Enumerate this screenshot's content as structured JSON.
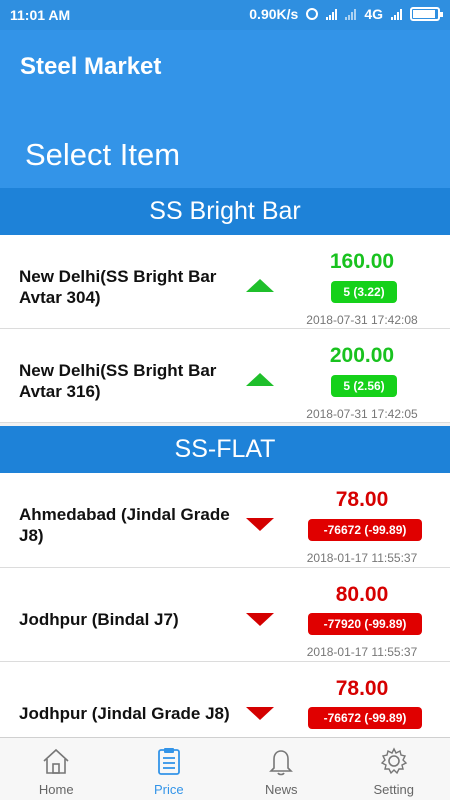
{
  "status_bar": {
    "time": "11:01 AM",
    "speed": "0.90K/s",
    "network": "4G"
  },
  "app_bar": {
    "title": "Steel Market",
    "subtitle": "Select Item"
  },
  "sections": [
    {
      "title": "SS Bright Bar",
      "rows": [
        {
          "name": "New Delhi(SS Bright Bar Avtar 304)",
          "direction": "up",
          "price": "160.00",
          "change": "5 (3.22)",
          "timestamp": "2018-07-31 17:42:08"
        },
        {
          "name": "New Delhi(SS Bright Bar Avtar 316)",
          "direction": "up",
          "price": "200.00",
          "change": "5 (2.56)",
          "timestamp": "2018-07-31 17:42:05"
        }
      ]
    },
    {
      "title": "SS-FLAT",
      "rows": [
        {
          "name": "Ahmedabad (Jindal Grade J8)",
          "direction": "down",
          "price": "78.00",
          "change": "-76672 (-99.89)",
          "timestamp": "2018-01-17 11:55:37"
        },
        {
          "name": "Jodhpur (Bindal J7)",
          "direction": "down",
          "price": "80.00",
          "change": "-77920 (-99.89)",
          "timestamp": "2018-01-17 11:55:37"
        },
        {
          "name": "Jodhpur (Jindal Grade J8)",
          "direction": "down",
          "price": "78.00",
          "change": "-76672 (-99.89)",
          "timestamp": ""
        }
      ]
    }
  ],
  "tabs": [
    {
      "label": "Home",
      "icon": "home-icon",
      "active": false
    },
    {
      "label": "Price",
      "icon": "clipboard-icon",
      "active": true
    },
    {
      "label": "News",
      "icon": "bell-icon",
      "active": false
    },
    {
      "label": "Setting",
      "icon": "gear-icon",
      "active": false
    }
  ],
  "colors": {
    "primary": "#3394e8",
    "section": "#1e82d8",
    "up": "#19c21f",
    "down": "#d60000"
  }
}
